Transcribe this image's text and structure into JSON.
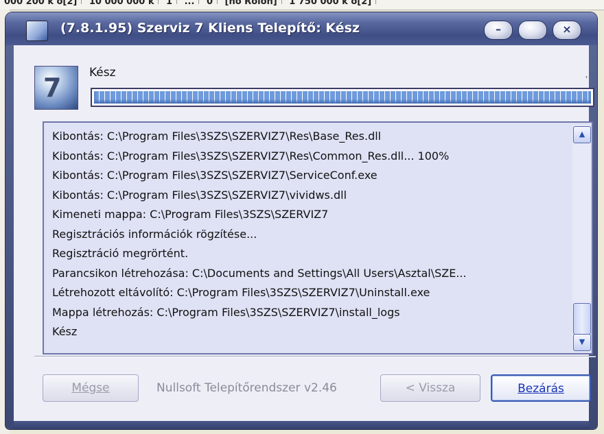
{
  "background": {
    "strip": [
      "000 200 k o[2]",
      "10 000 000 k",
      "1",
      "...",
      "0",
      "[no Roion]",
      "1 750 000 k o[2]"
    ]
  },
  "window": {
    "title": "(7.8.1.95) Szerviz 7 Kliens Telepítő: Kész",
    "controls": {
      "minimize": "–",
      "maximize": "",
      "close": "×"
    }
  },
  "header": {
    "status": "Kész",
    "progress_percent": 100
  },
  "log": {
    "lines": [
      "Kibontás: C:\\Program Files\\3SZS\\SZERVIZ7\\Res\\Base_Res.dll",
      "Kibontás: C:\\Program Files\\3SZS\\SZERVIZ7\\Res\\Common_Res.dll... 100%",
      "Kibontás: C:\\Program Files\\3SZS\\SZERVIZ7\\ServiceConf.exe",
      "Kibontás: C:\\Program Files\\3SZS\\SZERVIZ7\\vividws.dll",
      "Kimeneti mappa: C:\\Program Files\\3SZS\\SZERVIZ7",
      "Regisztrációs információk rögzítése...",
      "Regisztráció megrörtént.",
      "Parancsikon létrehozása: C:\\Documents and Settings\\All Users\\Asztal\\SZE...",
      "Létrehozott eltávolító: C:\\Program Files\\3SZS\\SZERVIZ7\\Uninstall.exe",
      "Mappa létrehozás: C:\\Program Files\\3SZS\\SZERVIZ7\\install_logs",
      "Kész"
    ]
  },
  "footer": {
    "cancel_label": "Mégse",
    "brand": "Nullsoft Telepítőrendszer v2.46",
    "back_label": "< Vissza",
    "close_label": "Bezárás"
  }
}
